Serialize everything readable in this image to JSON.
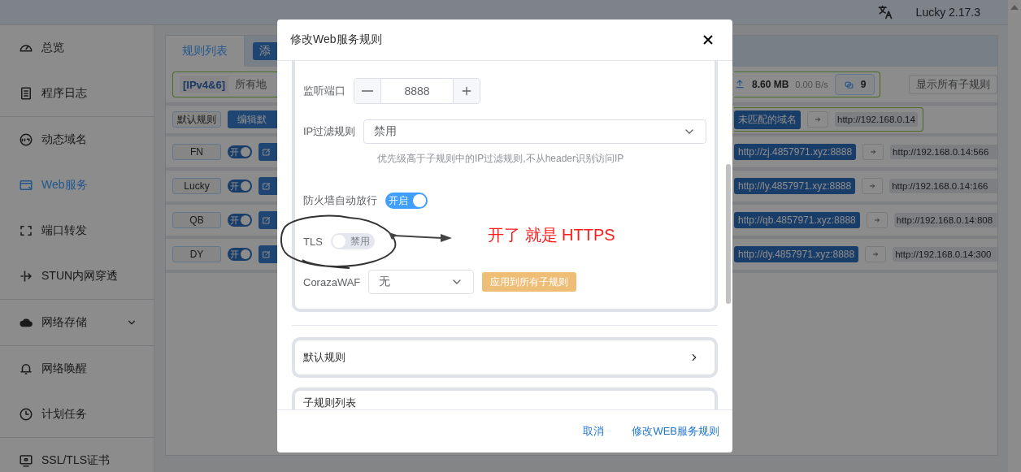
{
  "header": {
    "version": "Lucky 2.17.3"
  },
  "sidebar": {
    "items": [
      {
        "label": "总览",
        "selected": false
      },
      {
        "label": "程序日志",
        "selected": false
      },
      {
        "label": "动态域名",
        "selected": false
      },
      {
        "label": "Web服务",
        "selected": true
      },
      {
        "label": "端口转发",
        "selected": false
      },
      {
        "label": "STUN内网穿透",
        "selected": false
      },
      {
        "label": "网络存储",
        "selected": false,
        "expanded": false
      },
      {
        "label": "网络唤醒",
        "selected": false
      },
      {
        "label": "计划任务",
        "selected": false
      },
      {
        "label": "SSL/TLS证书",
        "selected": false
      }
    ]
  },
  "tabs": [
    {
      "label": "规则列表",
      "selected": true
    }
  ],
  "add_button": "添",
  "listener": {
    "address_type": "[IPv4&6]",
    "address": "所有地",
    "upload_total": "8.60 MB",
    "upload_rate": "0.00 B/s",
    "connections": "9"
  },
  "show_subrules_button": "显示所有子规则",
  "default_rule": {
    "label": "默认规则",
    "edit_button": "编辑默",
    "domain": "未匹配的域名",
    "target": "http://192.168.0.14"
  },
  "rules": [
    {
      "name": "FN",
      "enabled": true,
      "switch_text": "开",
      "domain": "http://zj.4857971.xyz:8888",
      "target": "http://192.168.0.14:566"
    },
    {
      "name": "Lucky",
      "enabled": true,
      "switch_text": "开",
      "domain": "http://ly.4857971.xyz:8888",
      "target": "http://192.168.0.14:166"
    },
    {
      "name": "QB",
      "enabled": true,
      "switch_text": "开",
      "domain": "http://qb.4857971.xyz:8888",
      "target": "http://192.168.0.14:808"
    },
    {
      "name": "DY",
      "enabled": true,
      "switch_text": "开",
      "domain": "http://dy.4857971.xyz:8888",
      "target": "http://192.168.0.14:300"
    }
  ],
  "dialog": {
    "title": "修改Web服务规则",
    "port": {
      "label": "监听端口",
      "value": "8888"
    },
    "ip_filter": {
      "label": "IP过滤规则",
      "value": "禁用",
      "hint": "优先级高于子规则中的IP过滤规则,不从header识别访问IP"
    },
    "firewall": {
      "label": "防火墙自动放行",
      "on": true,
      "text": "开启"
    },
    "tls": {
      "label": "TLS",
      "on": false,
      "text": "禁用"
    },
    "waf": {
      "label": "CorazaWAF",
      "value": "无",
      "apply_button": "应用到所有子规则"
    },
    "sections": [
      {
        "label": "默认规则"
      },
      {
        "label": "子规则列表"
      }
    ],
    "cancel_button": "取消",
    "confirm_button": "修改WEB服务规则"
  },
  "annotation": {
    "text": "开了 就是 HTTPS"
  }
}
